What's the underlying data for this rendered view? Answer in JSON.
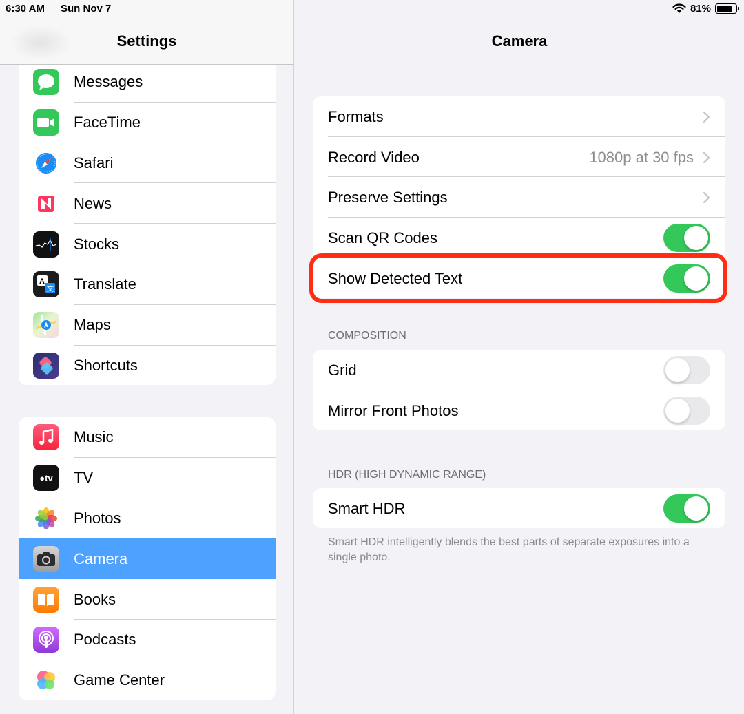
{
  "status_bar": {
    "time": "6:30 AM",
    "date": "Sun Nov 7",
    "battery": "81%",
    "battery_level": 0.81
  },
  "sidebar": {
    "title": "Settings",
    "group1": [
      {
        "label": "Messages",
        "icon": "messages-icon"
      },
      {
        "label": "FaceTime",
        "icon": "facetime-icon"
      },
      {
        "label": "Safari",
        "icon": "safari-icon"
      },
      {
        "label": "News",
        "icon": "news-icon"
      },
      {
        "label": "Stocks",
        "icon": "stocks-icon"
      },
      {
        "label": "Translate",
        "icon": "translate-icon"
      },
      {
        "label": "Maps",
        "icon": "maps-icon"
      },
      {
        "label": "Shortcuts",
        "icon": "shortcuts-icon"
      }
    ],
    "group2": [
      {
        "label": "Music",
        "icon": "music-icon"
      },
      {
        "label": "TV",
        "icon": "tv-icon"
      },
      {
        "label": "Photos",
        "icon": "photos-icon"
      },
      {
        "label": "Camera",
        "icon": "camera-icon",
        "selected": true
      },
      {
        "label": "Books",
        "icon": "books-icon"
      },
      {
        "label": "Podcasts",
        "icon": "podcasts-icon"
      },
      {
        "label": "Game Center",
        "icon": "game-center-icon"
      }
    ]
  },
  "detail": {
    "title": "Camera",
    "main_rows": [
      {
        "label": "Formats",
        "kind": "chevron"
      },
      {
        "label": "Record Video",
        "value": "1080p at 30 fps",
        "kind": "chevron"
      },
      {
        "label": "Preserve Settings",
        "kind": "chevron"
      },
      {
        "label": "Scan QR Codes",
        "kind": "toggle",
        "on": true
      },
      {
        "label": "Show Detected Text",
        "kind": "toggle",
        "on": true
      }
    ],
    "composition": {
      "header": "COMPOSITION",
      "rows": [
        {
          "label": "Grid",
          "kind": "toggle",
          "on": false
        },
        {
          "label": "Mirror Front Photos",
          "kind": "toggle",
          "on": false
        }
      ]
    },
    "hdr": {
      "header": "HDR (HIGH DYNAMIC RANGE)",
      "rows": [
        {
          "label": "Smart HDR",
          "kind": "toggle",
          "on": true
        }
      ],
      "footer": "Smart HDR intelligently blends the best parts of separate exposures into a single photo."
    }
  },
  "colors": {
    "toggle_on": "#34c759",
    "selection": "#4ea2ff",
    "highlight": "#ff2d14"
  }
}
